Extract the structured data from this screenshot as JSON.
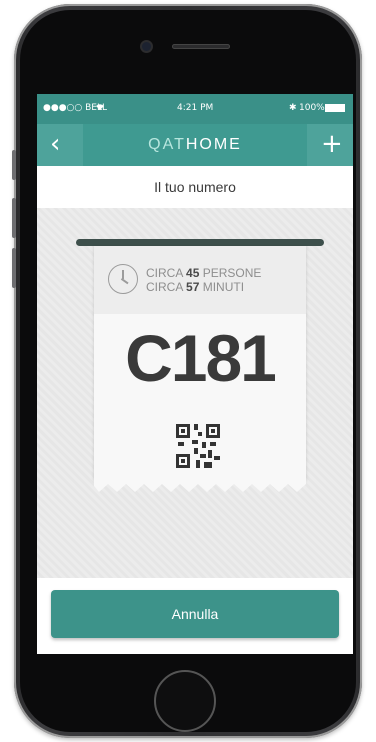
{
  "status_bar": {
    "carrier": "●●●○○ BELL",
    "time": "4:21 PM",
    "battery": "100%"
  },
  "navbar": {
    "title_accent": "QAT",
    "title_rest": "HOME",
    "back_glyph": "‹",
    "add_glyph": "+"
  },
  "subheader": "Il tuo numero",
  "ticket": {
    "line1_prefix": "CIRCA ",
    "people_count": "45",
    "line1_suffix": " PERSONE",
    "line2_prefix": "CIRCA ",
    "minutes_count": "57",
    "line2_suffix": " MINUTI",
    "number": "C181"
  },
  "actions": {
    "cancel_label": "Annulla"
  },
  "colors": {
    "teal": "#3f9a91",
    "teal_dark": "#3a9088",
    "text_dark": "#3a3a3a"
  }
}
